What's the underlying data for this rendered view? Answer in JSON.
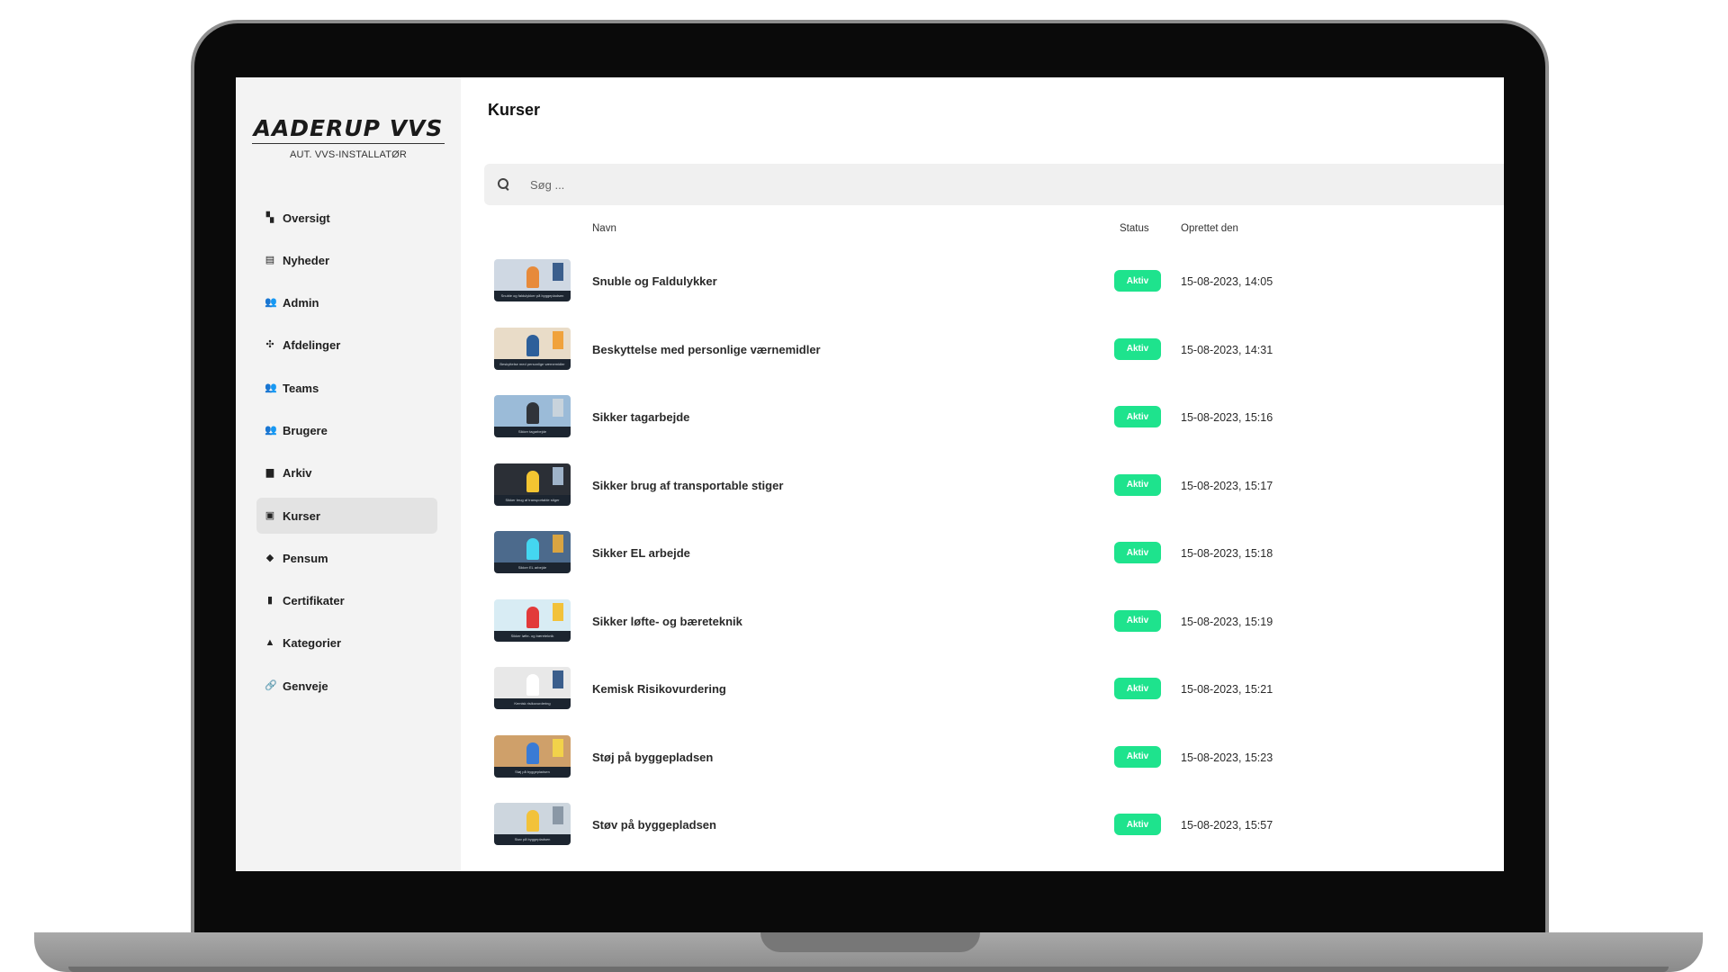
{
  "logo": {
    "title": "AADERUP VVS",
    "subtitle": "AUT. VVS-INSTALLATØR"
  },
  "sidebar": {
    "items": [
      {
        "label": "Oversigt",
        "icon": "dashboard-icon",
        "active": false
      },
      {
        "label": "Nyheder",
        "icon": "document-icon",
        "active": false
      },
      {
        "label": "Admin",
        "icon": "admin-users-icon",
        "active": false
      },
      {
        "label": "Afdelinger",
        "icon": "departments-icon",
        "active": false
      },
      {
        "label": "Teams",
        "icon": "teams-icon",
        "active": false
      },
      {
        "label": "Brugere",
        "icon": "users-icon",
        "active": false
      },
      {
        "label": "Arkiv",
        "icon": "archive-icon",
        "active": false
      },
      {
        "label": "Kurser",
        "icon": "courses-icon",
        "active": true
      },
      {
        "label": "Pensum",
        "icon": "graduation-cap-icon",
        "active": false
      },
      {
        "label": "Certifikater",
        "icon": "certificate-icon",
        "active": false
      },
      {
        "label": "Kategorier",
        "icon": "categories-icon",
        "active": false
      },
      {
        "label": "Genveje",
        "icon": "link-icon",
        "active": false
      }
    ]
  },
  "page": {
    "title": "Kurser"
  },
  "search": {
    "placeholder": "Søg ..."
  },
  "table": {
    "headers": {
      "name": "Navn",
      "status": "Status",
      "created": "Oprettet den"
    },
    "rows": [
      {
        "name": "Snuble og Faldulykker",
        "status": "Aktiv",
        "created": "15-08-2023, 14:05",
        "thumb_caption": "Snuble og faldulykker på byggepladsen"
      },
      {
        "name": "Beskyttelse med personlige værnemidler",
        "status": "Aktiv",
        "created": "15-08-2023, 14:31",
        "thumb_caption": "Beskyttelse med personlige værnemidler"
      },
      {
        "name": "Sikker tagarbejde",
        "status": "Aktiv",
        "created": "15-08-2023, 15:16",
        "thumb_caption": "Sikker tagarbejde"
      },
      {
        "name": "Sikker brug af transportable stiger",
        "status": "Aktiv",
        "created": "15-08-2023, 15:17",
        "thumb_caption": "Sikker brug af transportable stiger"
      },
      {
        "name": "Sikker EL arbejde",
        "status": "Aktiv",
        "created": "15-08-2023, 15:18",
        "thumb_caption": "Sikker EL arbejde"
      },
      {
        "name": "Sikker løfte- og bæreteknik",
        "status": "Aktiv",
        "created": "15-08-2023, 15:19",
        "thumb_caption": "Sikker løfte- og bæreteknik"
      },
      {
        "name": "Kemisk Risikovurdering",
        "status": "Aktiv",
        "created": "15-08-2023, 15:21",
        "thumb_caption": "Kemisk risikovurdering"
      },
      {
        "name": "Støj på byggepladsen",
        "status": "Aktiv",
        "created": "15-08-2023, 15:23",
        "thumb_caption": "Støj på byggepladsen"
      },
      {
        "name": "Støv på byggepladsen",
        "status": "Aktiv",
        "created": "15-08-2023, 15:57",
        "thumb_caption": "Støv på byggepladsen"
      }
    ]
  },
  "colors": {
    "accent_status": "#1ee38d",
    "sidebar_bg": "#f3f3f3",
    "active_item_bg": "#e3e3e3"
  }
}
